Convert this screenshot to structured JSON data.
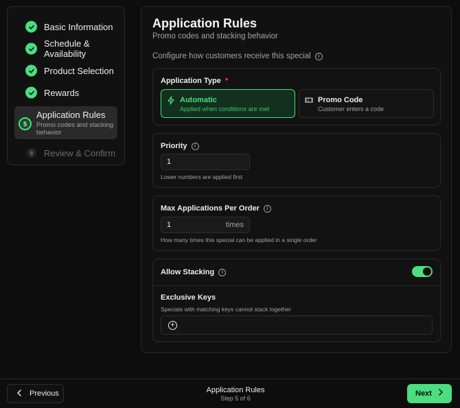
{
  "steps": [
    {
      "label": "Basic Information",
      "status": "done"
    },
    {
      "label": "Schedule & Availability",
      "status": "done"
    },
    {
      "label": "Product Selection",
      "status": "done"
    },
    {
      "label": "Rewards",
      "status": "done"
    },
    {
      "number": "5",
      "label": "Application Rules",
      "sub": "Promo codes and stacking behavior",
      "status": "active"
    },
    {
      "number": "6",
      "label": "Review & Confirm",
      "status": "pending"
    }
  ],
  "main": {
    "title": "Application Rules",
    "subtitle": "Promo codes and stacking behavior",
    "config_text": "Configure how customers receive this special",
    "application_type": {
      "label": "Application Type",
      "required_mark": "*",
      "options": [
        {
          "title": "Automatic",
          "sub": "Applied when conditions are met",
          "icon": "lightning-icon",
          "selected": true
        },
        {
          "title": "Promo Code",
          "sub": "Customer enters a code",
          "icon": "ticket-icon",
          "selected": false
        }
      ]
    },
    "priority": {
      "label": "Priority",
      "value": "1",
      "help": "Lower numbers are applied first"
    },
    "max_apps": {
      "label": "Max Applications Per Order",
      "value": "1",
      "suffix": "times",
      "help": "How many times this special can be applied in a single order"
    },
    "stacking": {
      "label": "Allow Stacking",
      "enabled": true
    },
    "exclusive_keys": {
      "label": "Exclusive Keys",
      "help": "Specials with matching keys cannot stack together"
    }
  },
  "footer": {
    "prev_label": "Previous",
    "title": "Application Rules",
    "step_text": "Step 5 of 6",
    "next_label": "Next"
  },
  "colors": {
    "accent": "#4ade80",
    "background": "#0d0d0d",
    "required": "#ef4444"
  }
}
